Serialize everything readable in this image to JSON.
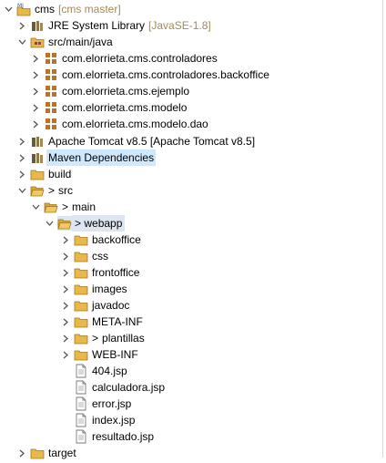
{
  "tree": {
    "root": {
      "label": "cms",
      "decoration": "[cms master]"
    },
    "jre": {
      "label": "JRE System Library",
      "decoration": "[JavaSE-1.8]"
    },
    "srcmain": {
      "label": "src/main/java"
    },
    "packages": [
      "com.elorrieta.cms.controladores",
      "com.elorrieta.cms.controladores.backoffice",
      "com.elorrieta.cms.ejemplo",
      "com.elorrieta.cms.modelo",
      "com.elorrieta.cms.modelo.dao"
    ],
    "tomcat": {
      "label": "Apache Tomcat v8.5 [Apache Tomcat v8.5]"
    },
    "maven": {
      "label": "Maven Dependencies"
    },
    "build": {
      "label": "build"
    },
    "src": {
      "prefix": ">",
      "label": "src"
    },
    "main": {
      "prefix": ">",
      "label": "main"
    },
    "webapp": {
      "prefix": ">",
      "label": "webapp"
    },
    "webapp_folders": [
      {
        "label": "backoffice",
        "prefix": ""
      },
      {
        "label": "css",
        "prefix": ""
      },
      {
        "label": "frontoffice",
        "prefix": ""
      },
      {
        "label": "images",
        "prefix": ""
      },
      {
        "label": "javadoc",
        "prefix": ""
      },
      {
        "label": "META-INF",
        "prefix": ""
      },
      {
        "label": "plantillas",
        "prefix": ">"
      },
      {
        "label": "WEB-INF",
        "prefix": ""
      }
    ],
    "files": [
      "404.jsp",
      "calculadora.jsp",
      "error.jsp",
      "index.jsp",
      "resultado.jsp"
    ],
    "target": {
      "label": "target"
    }
  },
  "colors": {
    "selection": "#cfe8fc",
    "decoration": "#a08c5a",
    "folder": "#e8b84a"
  }
}
